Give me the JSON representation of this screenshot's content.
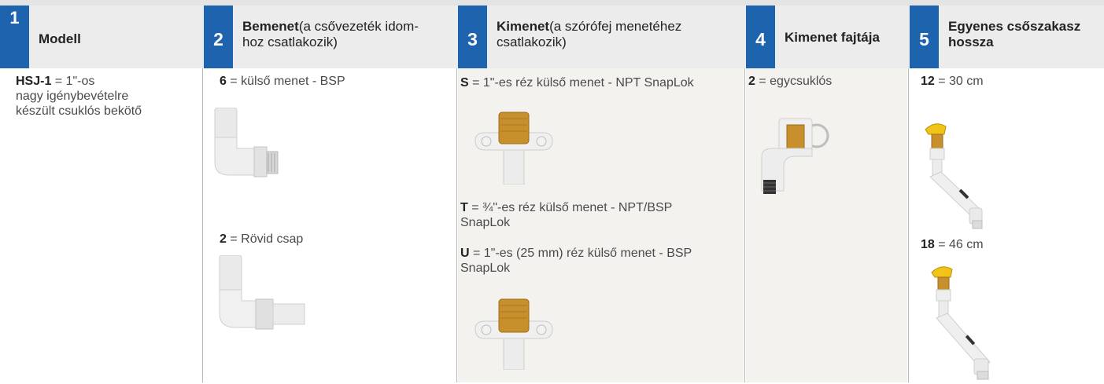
{
  "columns": [
    {
      "num": "1",
      "title_bold": "Modell",
      "title_rest": "",
      "entries": [
        {
          "code": "HSJ-1",
          "sep": " = ",
          "desc": "1\"-os",
          "desc2": "nagy igénybevételre",
          "desc3": "készült csuklós  bekötő"
        }
      ]
    },
    {
      "num": "2",
      "title_bold": "Bemenet",
      "title_rest": "(a csővezeték idom-",
      "title_rest2": "hoz csatlakozik)",
      "entries": [
        {
          "code": "6",
          "sep": " = ",
          "desc": "külső menet - BSP"
        },
        {
          "code": "2",
          "sep": " = ",
          "desc": "Rövid csap"
        }
      ]
    },
    {
      "num": "3",
      "title_bold": "Kimenet",
      "title_rest": "(a szórófej menetéhez",
      "title_rest2": "csatlakozik)",
      "entries": [
        {
          "code": "S",
          "sep": " = ",
          "desc": "1\"-es réz külső menet - NPT SnapLok"
        },
        {
          "code": "T",
          "sep": "  = ",
          "desc": "¾\"-es réz külső menet - NPT/BSP",
          "desc2": "SnapLok"
        },
        {
          "code": "U",
          "sep": " = ",
          "desc": "1\"-es (25 mm) réz külső menet - BSP",
          "desc2": "SnapLok"
        }
      ]
    },
    {
      "num": "4",
      "title_bold": "Kimenet fajtája",
      "title_rest": "",
      "entries": [
        {
          "code": "2",
          "sep": " = ",
          "desc": "egycsuklós"
        }
      ]
    },
    {
      "num": "5",
      "title_bold": "Egyenes csőszakasz",
      "title_rest": "",
      "title_bold2": "hossza",
      "entries": [
        {
          "code": "12",
          "sep": "  = ",
          "desc": "30 cm"
        },
        {
          "code": "18",
          "sep": "  = ",
          "desc": "46 cm"
        }
      ]
    }
  ],
  "colors": {
    "number_badge": "#1d63ad",
    "header_bg": "#ececec",
    "shaded_body": "#f4f2ef",
    "brass": "#c8902c",
    "pvc": "#eeeeee",
    "handle_yellow": "#f2c418"
  },
  "images": [
    "male-bsp-elbow-image",
    "short-nipple-elbow-image",
    "snaplok-outlet-s-image",
    "snaplok-outlet-u-image",
    "single-swivel-image",
    "swing-joint-12-image",
    "swing-joint-18-image"
  ]
}
